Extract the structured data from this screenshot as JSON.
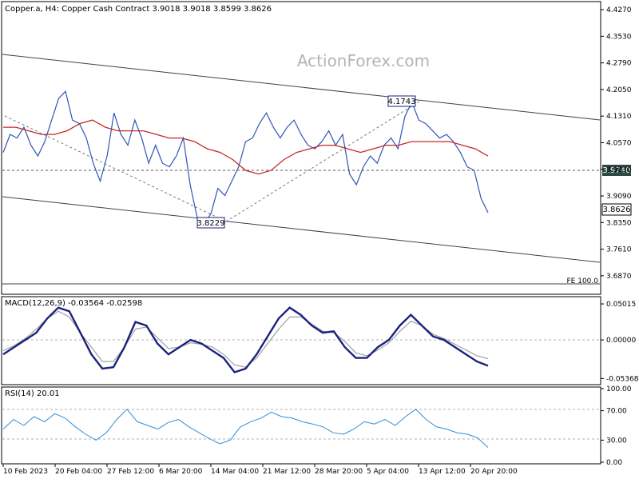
{
  "header": {
    "symbol_info": "Copper.a, H4:  Copper Cash Contract  3.9018 3.9018 3.8599 3.8626"
  },
  "watermark": "ActionForex.com",
  "colors": {
    "price_line": "#2f55b8",
    "moving_average": "#c62828",
    "macd_main": "#1a237e",
    "macd_signal": "#a0a0a0",
    "rsi_line": "#2f8fd8",
    "channel": "#404050",
    "dashed_guides": "#7a7a7a",
    "label_dark_bg": "#2e4a45",
    "grid": "#c8c8c8"
  },
  "chart_data": [
    {
      "type": "line",
      "title": "Copper.a, H4:  Copper Cash Contract  3.9018 3.9018 3.8599 3.8626",
      "x": [
        "10 Feb 2023",
        "20 Feb 04:00",
        "27 Feb 12:00",
        "6 Mar 20:00",
        "14 Mar 04:00",
        "21 Mar 12:00",
        "28 Mar 20:00",
        "5 Apr 04:00",
        "13 Apr 12:00",
        "20 Apr 20:00"
      ],
      "y_ticks": [
        "4.4270",
        "4.3530",
        "4.2790",
        "4.2050",
        "4.1310",
        "4.0570",
        "3.9830",
        "3.9090",
        "3.8350",
        "3.7610",
        "3.6870"
      ],
      "ylim": [
        3.64,
        4.445
      ],
      "series": [
        {
          "key": "price",
          "values": [
            4.03,
            4.08,
            4.07,
            4.1,
            4.05,
            4.02,
            4.06,
            4.12,
            4.18,
            4.2,
            4.12,
            4.11,
            4.07,
            4.0,
            3.95,
            4.02,
            4.14,
            4.08,
            4.05,
            4.12,
            4.07,
            4.0,
            4.05,
            4.0,
            3.99,
            4.02,
            4.07,
            3.94,
            3.85,
            3.83,
            3.86,
            3.93,
            3.91,
            3.95,
            3.99,
            4.06,
            4.07,
            4.11,
            4.14,
            4.1,
            4.07,
            4.1,
            4.12,
            4.08,
            4.05,
            4.04,
            4.06,
            4.09,
            4.05,
            4.08,
            3.97,
            3.94,
            3.99,
            4.02,
            4.0,
            4.05,
            4.07,
            4.04,
            4.13,
            4.17,
            4.12,
            4.11,
            4.09,
            4.07,
            4.08,
            4.06,
            4.03,
            3.99,
            3.98,
            3.9018,
            3.8626
          ]
        },
        {
          "key": "moving_average",
          "values": [
            4.1,
            4.1,
            4.09,
            4.08,
            4.08,
            4.09,
            4.11,
            4.12,
            4.1,
            4.09,
            4.09,
            4.09,
            4.08,
            4.07,
            4.07,
            4.06,
            4.04,
            4.03,
            4.01,
            3.98,
            3.97,
            3.98,
            4.01,
            4.03,
            4.04,
            4.05,
            4.05,
            4.04,
            4.03,
            4.04,
            4.05,
            4.05,
            4.06,
            4.06,
            4.06,
            4.06,
            4.05,
            4.04,
            4.02
          ]
        }
      ],
      "annotations": [
        {
          "text": "4.1743",
          "style": "boxed"
        },
        {
          "text": "3.8229",
          "style": "boxed"
        },
        {
          "text": "3.9740",
          "style": "filled"
        },
        {
          "text": "3.8626",
          "style": "boxed"
        },
        {
          "text": "FE 100.0",
          "style": "plain"
        }
      ],
      "grid": false
    },
    {
      "type": "line",
      "title": "MACD(12,26,9) -0.03564 -0.02598",
      "y_ticks": [
        "0.05015",
        "0.00000",
        "-0.05368"
      ],
      "ylim": [
        -0.06,
        0.058
      ],
      "series": [
        {
          "key": "macd",
          "values": [
            -0.02,
            -0.01,
            0.0,
            0.01,
            0.03,
            0.045,
            0.04,
            0.01,
            -0.02,
            -0.04,
            -0.038,
            -0.01,
            0.025,
            0.02,
            -0.005,
            -0.02,
            -0.01,
            0.0,
            -0.005,
            -0.015,
            -0.025,
            -0.045,
            -0.04,
            -0.02,
            0.005,
            0.03,
            0.045,
            0.035,
            0.02,
            0.01,
            0.012,
            -0.01,
            -0.025,
            -0.025,
            -0.01,
            0.0,
            0.02,
            0.035,
            0.02,
            0.005,
            0.0,
            -0.01,
            -0.02,
            -0.03,
            -0.036
          ]
        },
        {
          "key": "signal",
          "values": [
            -0.015,
            -0.008,
            0.002,
            0.015,
            0.03,
            0.04,
            0.032,
            0.01,
            -0.01,
            -0.03,
            -0.03,
            -0.01,
            0.015,
            0.018,
            0.003,
            -0.012,
            -0.01,
            -0.004,
            -0.006,
            -0.01,
            -0.02,
            -0.035,
            -0.038,
            -0.025,
            -0.005,
            0.015,
            0.032,
            0.032,
            0.022,
            0.012,
            0.01,
            -0.002,
            -0.018,
            -0.022,
            -0.014,
            -0.004,
            0.012,
            0.026,
            0.02,
            0.008,
            0.002,
            -0.006,
            -0.014,
            -0.022,
            -0.026
          ]
        }
      ],
      "grid": false
    },
    {
      "type": "line",
      "title": "RSI(14) 20.01",
      "y_ticks": [
        "100.00",
        "70.00",
        "30.00",
        "0.00"
      ],
      "ylim": [
        0,
        100
      ],
      "series": [
        {
          "key": "rsi",
          "values": [
            45,
            58,
            50,
            62,
            55,
            66,
            60,
            48,
            38,
            30,
            40,
            58,
            72,
            55,
            50,
            45,
            54,
            58,
            48,
            40,
            32,
            25,
            30,
            48,
            55,
            60,
            68,
            62,
            60,
            55,
            52,
            48,
            40,
            38,
            45,
            55,
            52,
            58,
            50,
            62,
            72,
            58,
            48,
            45,
            40,
            38,
            33,
            20
          ]
        }
      ],
      "grid": false
    }
  ]
}
